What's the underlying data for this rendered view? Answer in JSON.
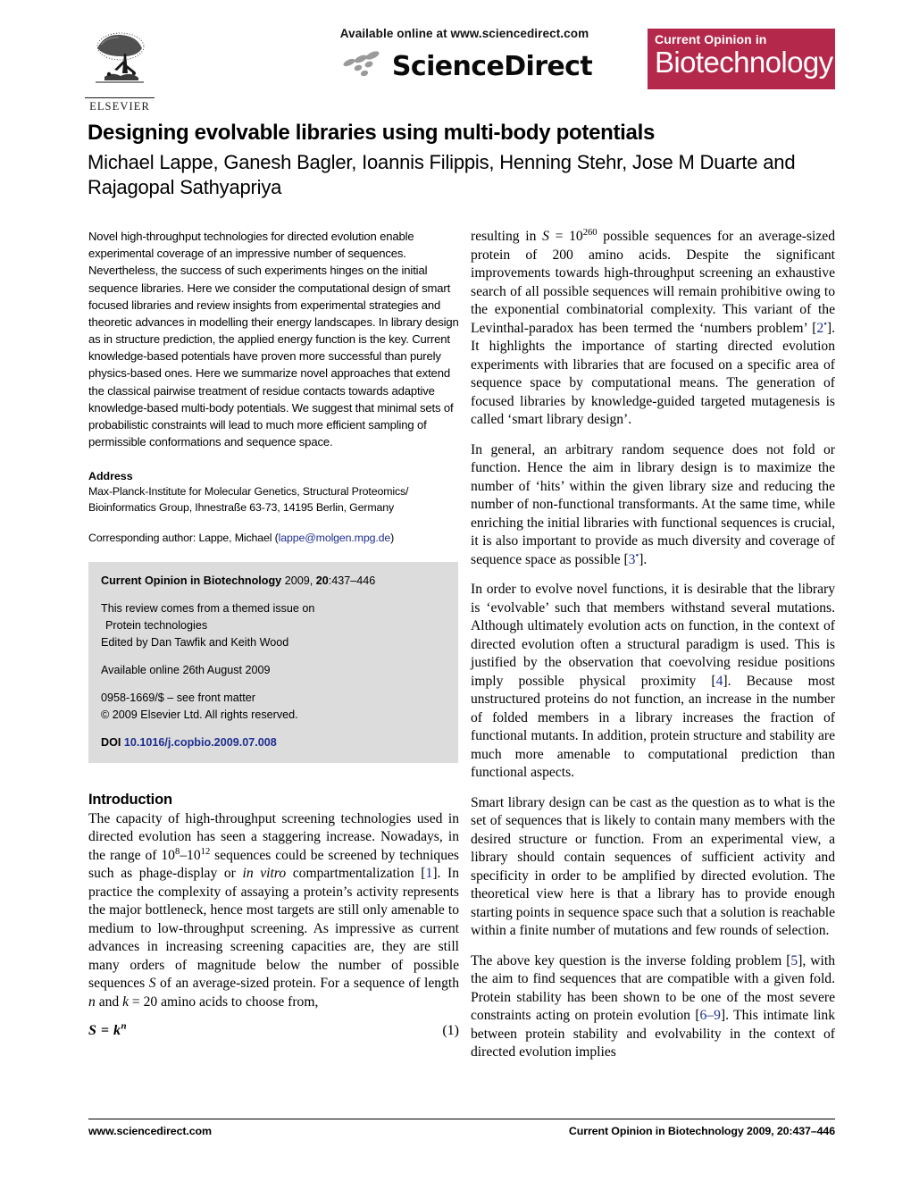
{
  "header": {
    "available_online": "Available online at www.sciencedirect.com",
    "sciencedirect_wordmark": "ScienceDirect",
    "elsevier_wordmark": "ELSEVIER",
    "journal_badge_top": "Current Opinion in",
    "journal_badge_main": "Biotechnology",
    "badge_color": "#b4284b"
  },
  "title": "Designing evolvable libraries using multi-body potentials",
  "authors": "Michael Lappe, Ganesh Bagler, Ioannis Filippis, Henning Stehr, Jose M Duarte and Rajagopal Sathyapriya",
  "abstract": "Novel high-throughput technologies for directed evolution enable experimental coverage of an impressive number of sequences. Nevertheless, the success of such experiments hinges on the initial sequence libraries. Here we consider the computational design of smart focused libraries and review insights from experimental strategies and theoretic advances in modelling their energy landscapes. In library design as in structure prediction, the applied energy function is the key. Current knowledge-based potentials have proven more successful than purely physics-based ones. Here we summarize novel approaches that extend the classical pairwise treatment of residue contacts towards adaptive knowledge-based multi-body potentials. We suggest that minimal sets of probabilistic constraints will lead to much more efficient sampling of permissible conformations and sequence space.",
  "address": {
    "heading": "Address",
    "line1": "Max-Planck-Institute for Molecular Genetics, Structural Proteomics/",
    "line2": "Bioinformatics Group, Ihnestraße 63-73, 14195 Berlin, Germany",
    "corresponding_prefix": "Corresponding author: Lappe, Michael (",
    "corresponding_email": "lappe@molgen.mpg.de",
    "corresponding_suffix": ")"
  },
  "metabox": {
    "journal_name": "Current Opinion in Biotechnology",
    "journal_year": " 2009, ",
    "journal_volume": "20",
    "journal_pages": ":437–446",
    "themed_line1": "This review comes from a themed issue on",
    "themed_line2": "Protein technologies",
    "edited_by": "Edited by Dan Tawfik and Keith Wood",
    "available_online": "Available online 26th August 2009",
    "issn_line": "0958-1669/$ – see front matter",
    "copyright_line": "2009 Elsevier Ltd. All rights reserved.",
    "copyright_symbol": "©",
    "doi_label": "DOI",
    "doi_value": "10.1016/j.copbio.2009.07.008"
  },
  "sections": {
    "introduction_heading": "Introduction"
  },
  "left_column": {
    "intro_p1_a": "The capacity of high-throughput screening technologies used in directed evolution has seen a staggering increase. Nowadays, in the range of 10",
    "intro_p1_exp1": "8",
    "intro_p1_b": "–10",
    "intro_p1_exp2": "12",
    "intro_p1_c": " sequences could be screened by techniques such as phage-display or ",
    "intro_p1_ital": "in vitro",
    "intro_p1_d": " compartmentalization [",
    "intro_p1_ref": "1",
    "intro_p1_e": "]. In practice the complexity of assaying a protein’s activity represents the major bottleneck, hence most targets are still only amenable to medium to low-throughput screening. As impressive as current advances in increasing screening capacities are, they are still many orders of magnitude below the number of possible sequences ",
    "intro_p1_S": "S",
    "intro_p1_f": " of an average-sized protein. For a sequence of length ",
    "intro_p1_n": "n",
    "intro_p1_g": " and ",
    "intro_p1_k": "k",
    "intro_p1_h": " = 20 amino acids to choose from,",
    "equation": "S = k",
    "equation_exp": "n",
    "equation_number": "(1)"
  },
  "right_column": {
    "p1_a": "resulting in ",
    "p1_S": "S",
    "p1_b": " = 10",
    "p1_exp": "260",
    "p1_c": " possible sequences for an average-sized protein of 200 amino acids. Despite the significant improvements towards high-throughput screening an exhaustive search of all possible sequences will remain prohibitive owing to the exponential combinatorial complexity. This variant of the Levinthal-paradox has been termed the ‘numbers problem’ [",
    "p1_ref": "2",
    "p1_ref_star": "•",
    "p1_d": "]. It highlights the importance of starting directed evolution experiments with libraries that are focused on a specific area of sequence space by computational means. The generation of focused libraries by knowledge-guided targeted mutagenesis is called ‘smart library design’.",
    "p2_a": "In general, an arbitrary random sequence does not fold or function. Hence the aim in library design is to maximize the number of ‘hits’ within the given library size and reducing the number of non-functional transformants. At the same time, while enriching the initial libraries with functional sequences is crucial, it is also important to provide as much diversity and coverage of sequence space as possible [",
    "p2_ref": "3",
    "p2_ref_star": "•",
    "p2_b": "].",
    "p3_a": "In order to evolve novel functions, it is desirable that the library is ‘evolvable’ such that members withstand several mutations. Although ultimately evolution acts on function, in the context of directed evolution often a structural paradigm is used. This is justified by the observation that coevolving residue positions imply possible physical proximity [",
    "p3_ref": "4",
    "p3_b": "]. Because most unstructured proteins do not function, an increase in the number of folded members in a library increases the fraction of functional mutants. In addition, protein structure and stability are much more amenable to computational prediction than functional aspects.",
    "p4": "Smart library design can be cast as the question as to what is the set of sequences that is likely to contain many members with the desired structure or function. From an experimental view, a library should contain sequences of sufficient activity and specificity in order to be amplified by directed evolution. The theoretical view here is that a library has to provide enough starting points in sequence space such that a solution is reachable within a finite number of mutations and few rounds of selection.",
    "p5_a": "The above key question is the inverse folding problem [",
    "p5_ref1": "5",
    "p5_b": "], with the aim to find sequences that are compatible with a given fold. Protein stability has been shown to be one of the most severe constraints acting on protein evolution [",
    "p5_ref2": "6–9",
    "p5_c": "]. This intimate link between protein stability and evolvability in the context of directed evolution implies"
  },
  "footer": {
    "left": "www.sciencedirect.com",
    "right_journal": "Current Opinion in Biotechnology",
    "right_rest": " 2009, 20:437–446"
  }
}
